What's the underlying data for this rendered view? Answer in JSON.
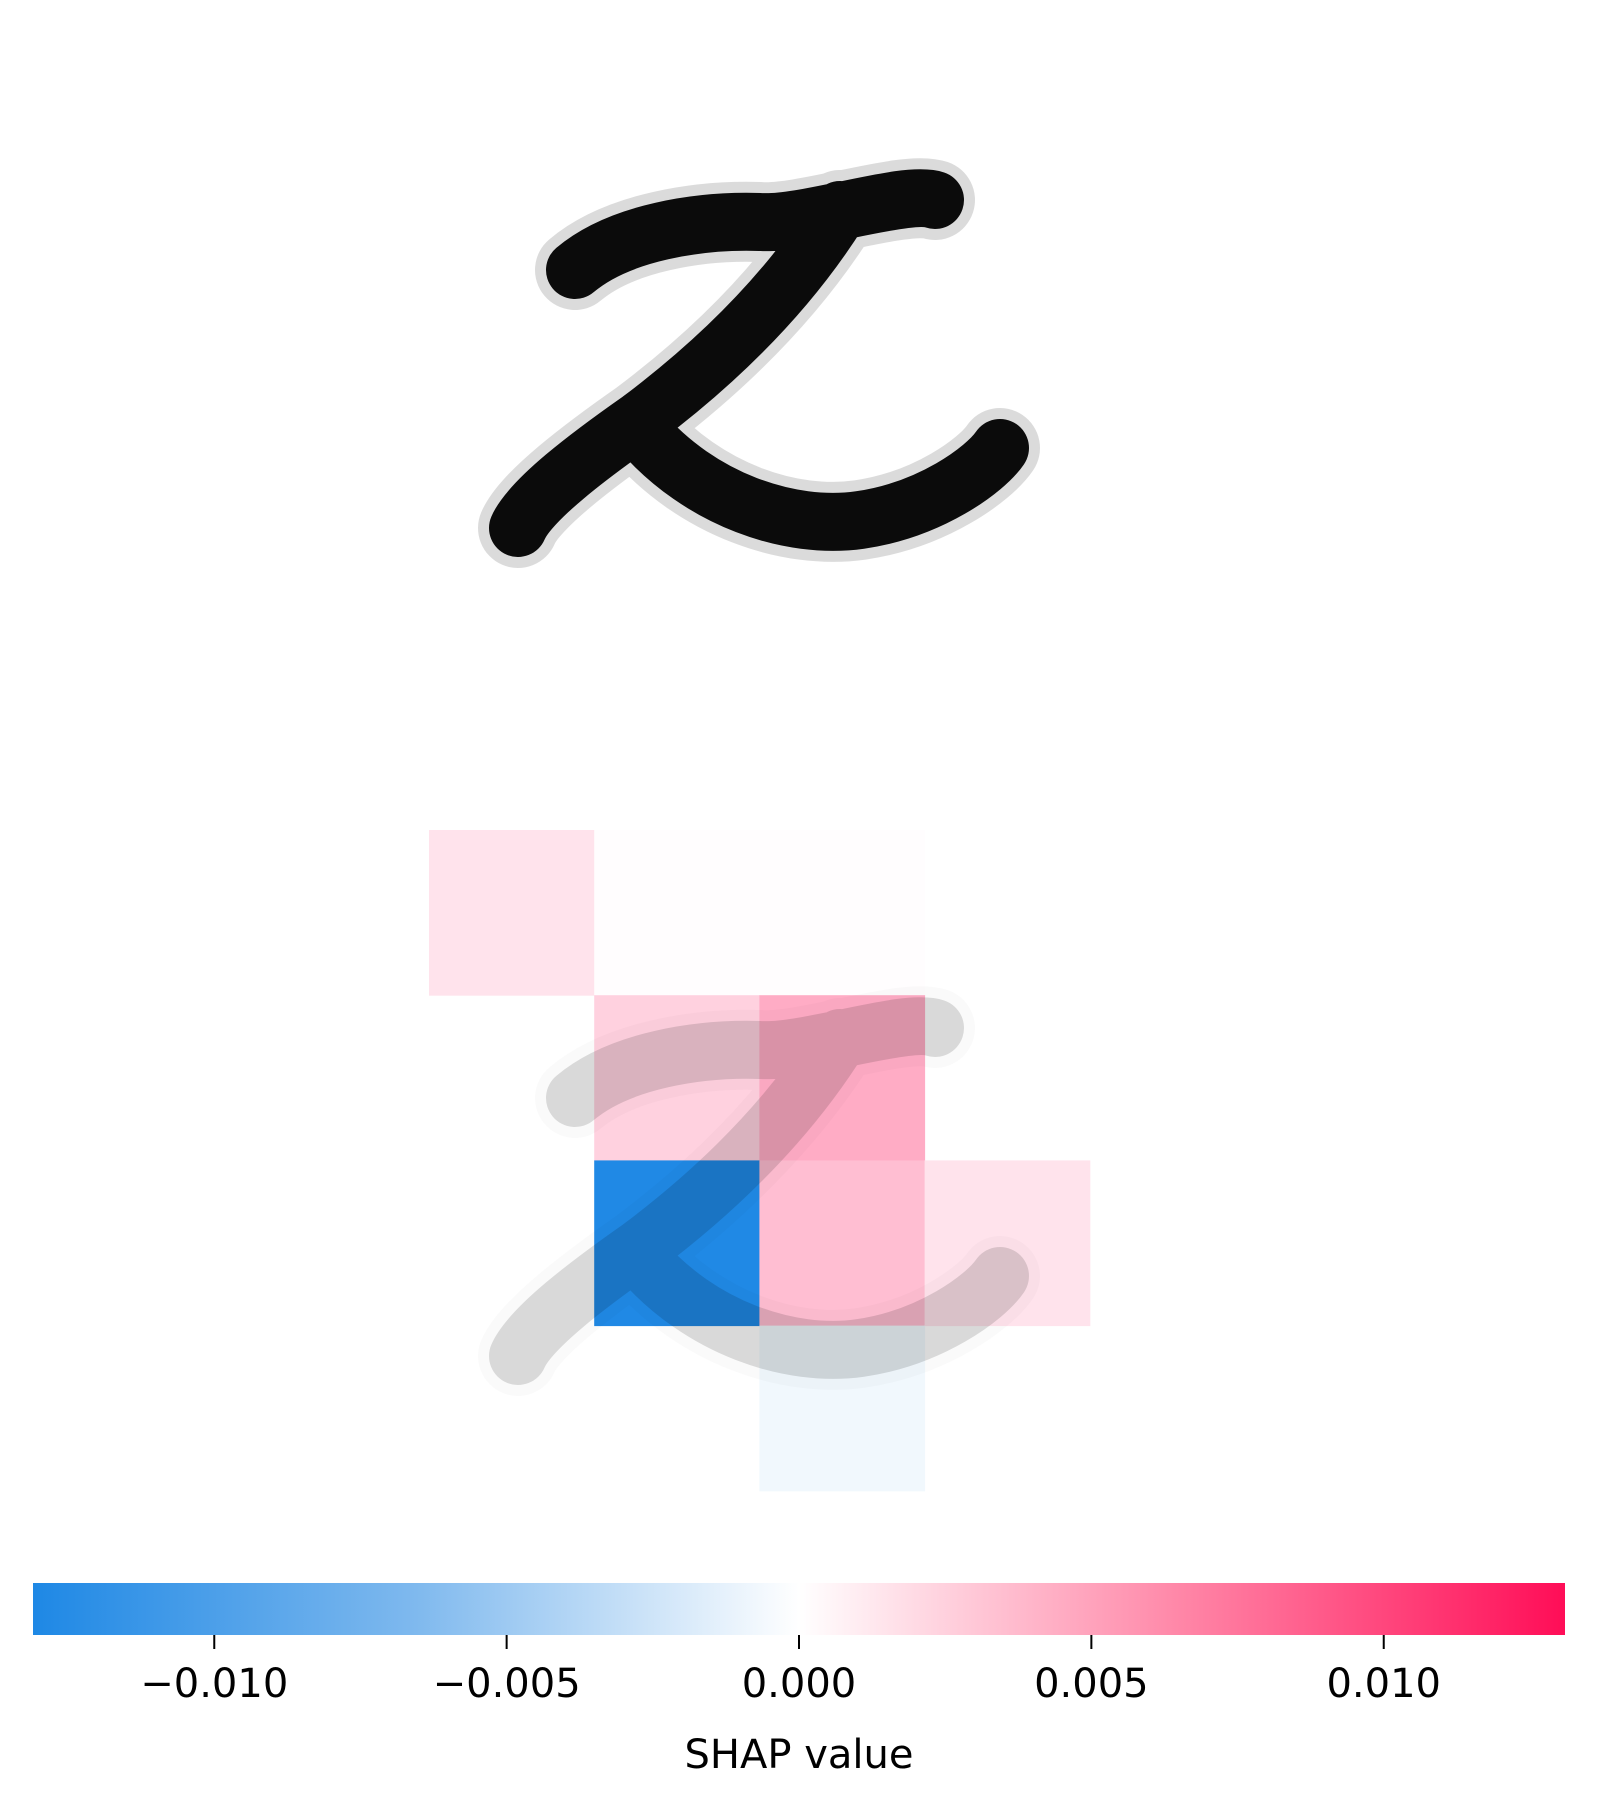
{
  "chart_data": [
    {
      "type": "image",
      "description_id": "input-digit"
    },
    {
      "type": "heatmap",
      "grid": {
        "rows": 28,
        "cols": 28,
        "cell_block": 7
      },
      "blocks": [
        {
          "row": 0,
          "col": 0,
          "value": 0.0015
        },
        {
          "row": 0,
          "col": 1,
          "value": 0.0001
        },
        {
          "row": 0,
          "col": 2,
          "value": 0.0001
        },
        {
          "row": 1,
          "col": 1,
          "value": 0.0025
        },
        {
          "row": 1,
          "col": 2,
          "value": 0.0045
        },
        {
          "row": 2,
          "col": 1,
          "value": -0.013
        },
        {
          "row": 2,
          "col": 2,
          "value": 0.0035
        },
        {
          "row": 2,
          "col": 3,
          "value": 0.0015
        },
        {
          "row": 3,
          "col": 2,
          "value": -0.0008
        }
      ],
      "colorbar": {
        "label": "SHAP value",
        "min": -0.0131,
        "max": 0.0131,
        "ticks": [
          -0.01,
          -0.005,
          0.0,
          0.005,
          0.01
        ],
        "tick_labels": [
          "−0.010",
          "−0.005",
          "0.000",
          "0.005",
          "0.010"
        ],
        "negative_color": "#1e88e5",
        "positive_color": "#ff0d57",
        "mid_color": "#ffffff"
      }
    }
  ]
}
